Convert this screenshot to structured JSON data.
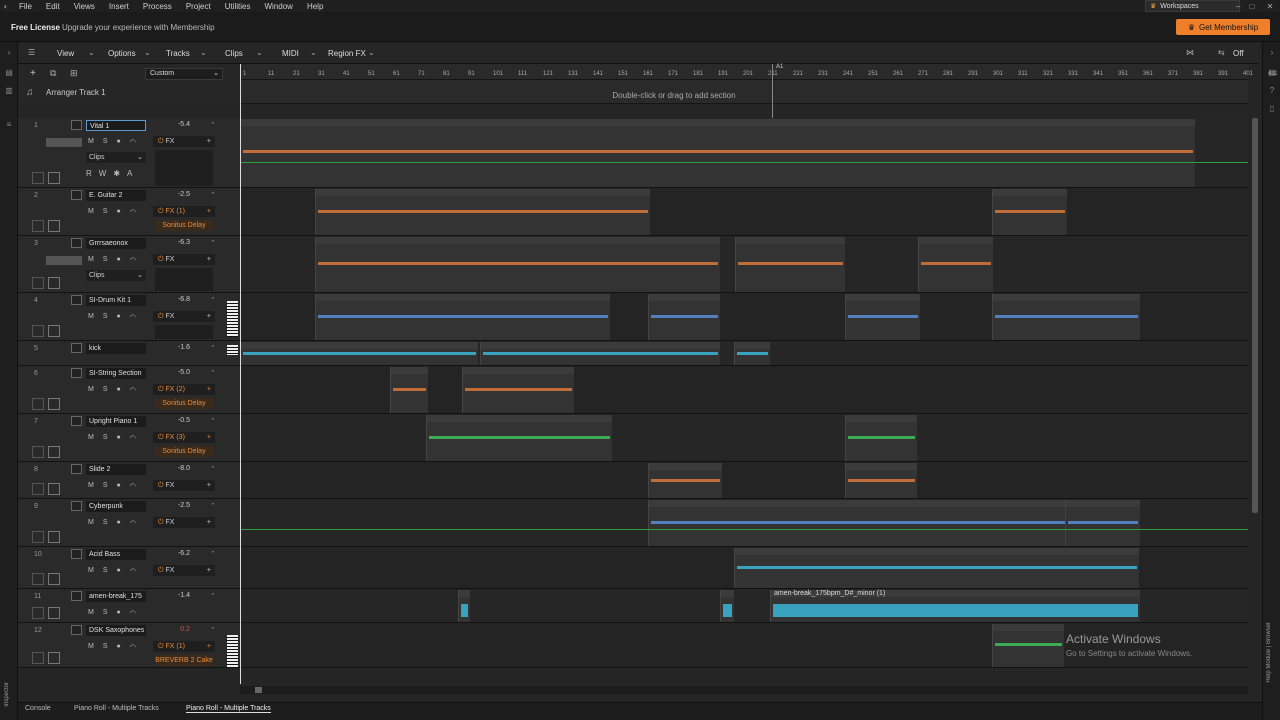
{
  "menu": [
    "File",
    "Edit",
    "Views",
    "Insert",
    "Process",
    "Project",
    "Utilities",
    "Window",
    "Help"
  ],
  "workspaces": "Workspaces",
  "license": {
    "title": "Free License",
    "subtitle": "Upgrade your experience with Membership",
    "button": "Get Membership"
  },
  "toolbar": {
    "view": "View",
    "options": "Options",
    "tracks": "Tracks",
    "clips": "Clips",
    "midi": "MIDI",
    "region_fx": "Region FX",
    "off": "Off"
  },
  "header": {
    "preset": "Custom",
    "arranger_name": "Arranger Track 1"
  },
  "arranger_hint": "Double-click or drag to add section",
  "locator_label": "A1",
  "ruler_ticks": [
    "1",
    "11",
    "21",
    "31",
    "41",
    "51",
    "61",
    "71",
    "81",
    "91",
    "101",
    "111",
    "121",
    "131",
    "141",
    "151",
    "161",
    "171",
    "181",
    "191",
    "201",
    "211",
    "221",
    "231",
    "241",
    "251",
    "261",
    "271",
    "281",
    "291",
    "301",
    "311",
    "321",
    "331",
    "341",
    "351",
    "361",
    "371",
    "381",
    "391",
    "401",
    "411",
    "421",
    "431"
  ],
  "tracks": [
    {
      "num": "1",
      "name": "Vital 1",
      "vol": "-5.4",
      "fx": "FX",
      "plugin": "",
      "clips": "Clips",
      "selected": true
    },
    {
      "num": "2",
      "name": "E. Guitar 2",
      "vol": "-2.5",
      "fx": "FX (1)",
      "plugin": "Sonitus Delay",
      "clips": ""
    },
    {
      "num": "3",
      "name": "Grrrsaeonox",
      "vol": "-6.3",
      "fx": "FX",
      "plugin": "",
      "clips": "Clips"
    },
    {
      "num": "4",
      "name": "SI-Drum Kit 1",
      "vol": "-6.8",
      "fx": "FX",
      "plugin": "",
      "clips": ""
    },
    {
      "num": "5",
      "name": "kick",
      "vol": "-1.6",
      "fx": "",
      "plugin": "",
      "clips": ""
    },
    {
      "num": "6",
      "name": "SI-String Section",
      "vol": "-5.0",
      "fx": "FX (2)",
      "plugin": "Sonitus Delay",
      "clips": ""
    },
    {
      "num": "7",
      "name": "Upright Piano 1",
      "vol": "-0.5",
      "fx": "FX (3)",
      "plugin": "Sonitus Delay",
      "clips": ""
    },
    {
      "num": "8",
      "name": "Slide 2",
      "vol": "-8.0",
      "fx": "FX",
      "plugin": "",
      "clips": ""
    },
    {
      "num": "9",
      "name": "Cyberpunk",
      "vol": "-2.5",
      "fx": "FX",
      "plugin": "",
      "clips": ""
    },
    {
      "num": "10",
      "name": "Acid Bass",
      "vol": "-6.2",
      "fx": "FX",
      "plugin": "",
      "clips": ""
    },
    {
      "num": "11",
      "name": "amen-break_175",
      "vol": "-1.4",
      "fx": "",
      "plugin": "",
      "clips": ""
    },
    {
      "num": "12",
      "name": "DSK Saxophones",
      "vol": "0.2",
      "fx": "FX (1)",
      "plugin": "BREVERB 2 Cake",
      "clips": ""
    }
  ],
  "audio_clip_label": "amen-break_175bpm_D#_minor (1)",
  "bottom_tabs": [
    "Console",
    "Piano Roll - Multiple Tracks",
    "Piano Roll - Multiple Tracks"
  ],
  "watermark": {
    "line1": "Activate Windows",
    "line2": "Go to Settings to activate Windows."
  },
  "inspector_label": "Inspector",
  "help_label": "Help Module | Browser",
  "colors": {
    "accent": "#ef7f2b",
    "midi_orange": "#d9783a",
    "midi_green": "#3fbf5a",
    "midi_blue": "#5a8fd6",
    "audio_cyan": "#39b6d8",
    "automation_green": "#2e9e3a"
  }
}
